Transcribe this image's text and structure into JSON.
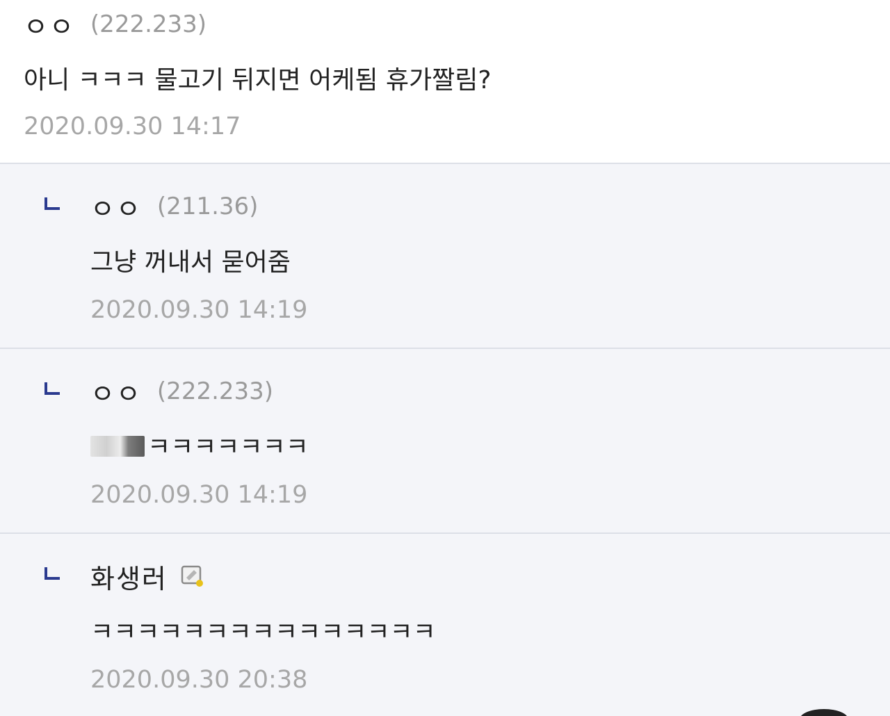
{
  "comments": [
    {
      "nickname": "ㅇㅇ",
      "ip": "(222.233)",
      "text": "아니 ㅋㅋㅋ 물고기 뒤지면 어케됨 휴가짤림?",
      "date": "2020.09.30 14:17"
    },
    {
      "nickname": "ㅇㅇ",
      "ip": "(211.36)",
      "text": "그냥 꺼내서 묻어줌",
      "date": "2020.09.30 14:19"
    },
    {
      "nickname": "ㅇㅇ",
      "ip": "(222.233)",
      "text": "ㅋㅋㅋㅋㅋㅋㅋ",
      "date": "2020.09.30 14:19"
    },
    {
      "nickname": "화생러",
      "text": "ㅋㅋㅋㅋㅋㅋㅋㅋㅋㅋㅋㅋㅋㅋㅋ",
      "date": "2020.09.30 20:38"
    }
  ],
  "icons": {
    "reply_marker": "reply-arrow-icon",
    "memo": "memo-icon"
  },
  "colors": {
    "reply_marker": "#2a3a8f",
    "reply_background": "#f4f5f9",
    "memo_badge": "#e8c21a"
  }
}
